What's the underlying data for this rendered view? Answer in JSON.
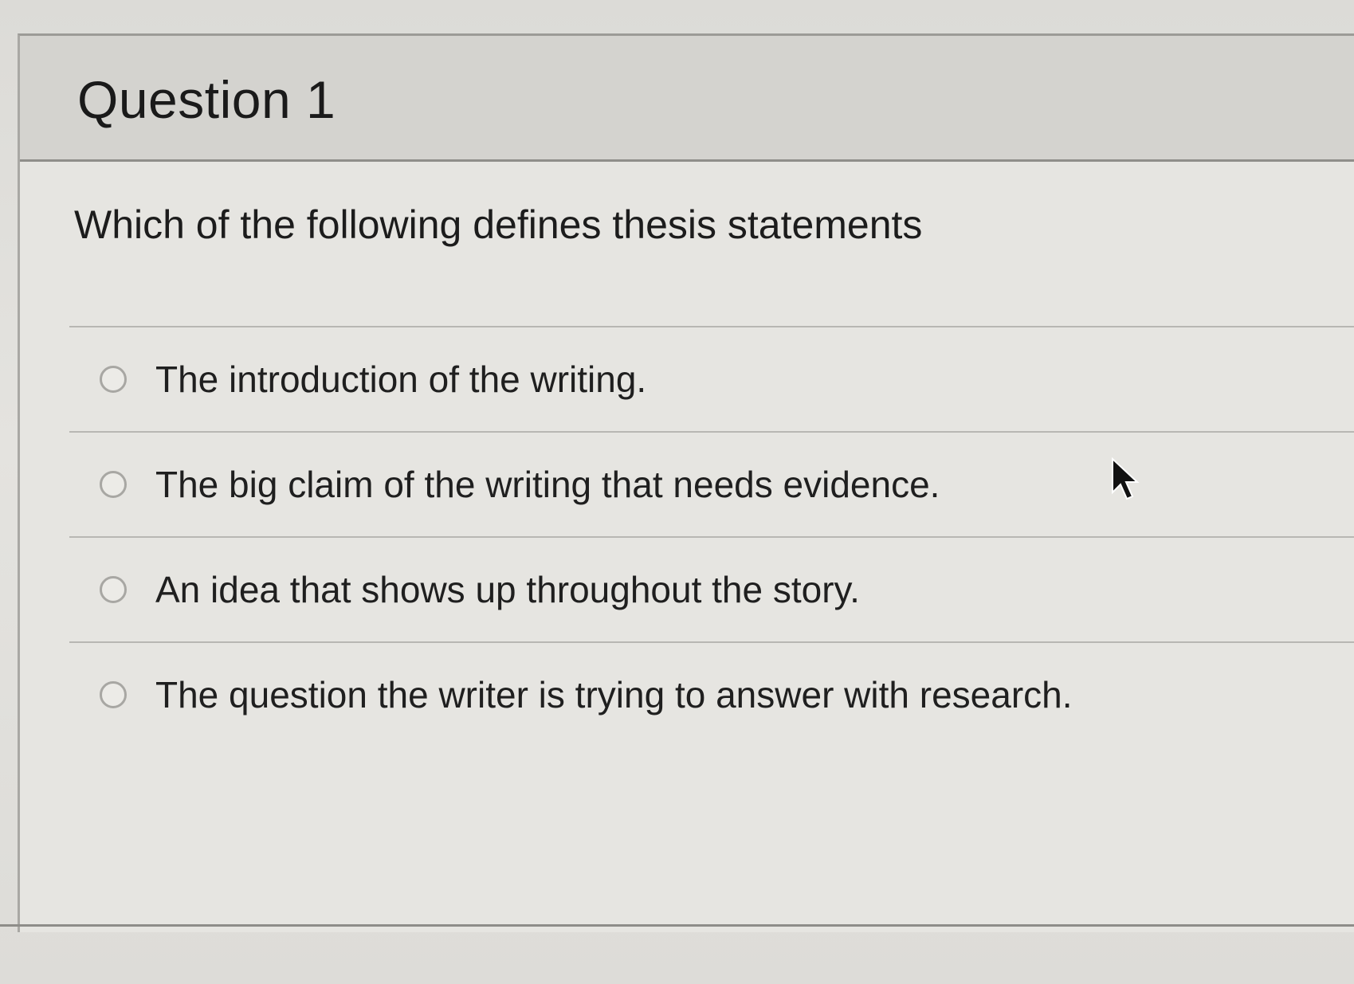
{
  "question": {
    "title": "Question 1",
    "prompt": "Which of the following defines thesis statements",
    "options": [
      {
        "label": "The introduction of the writing.",
        "selected": false
      },
      {
        "label": "The big claim of the writing that needs evidence.",
        "selected": false
      },
      {
        "label": "An idea that shows up throughout the story.",
        "selected": false
      },
      {
        "label": "The question the writer is trying to answer with research.",
        "selected": false
      }
    ]
  },
  "icons": {
    "radio": "radio-button-icon",
    "cursor": "mouse-pointer-icon"
  },
  "colors": {
    "header_background": "#d4d3cf",
    "card_background": "#e6e5e1",
    "text": "#1e1e1e"
  }
}
